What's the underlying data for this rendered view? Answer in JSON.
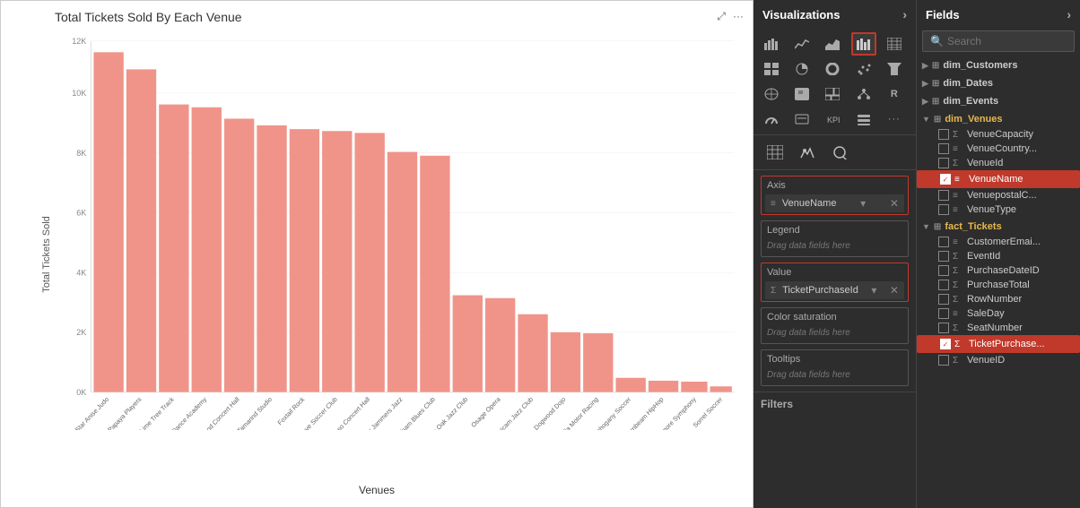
{
  "chart": {
    "title": "Total Tickets Sold By Each Venue",
    "y_label": "Total Tickets Sold",
    "x_label": "Venues",
    "y_ticks": [
      "0K",
      "2K",
      "4K",
      "6K",
      "8K",
      "10K",
      "12K"
    ],
    "bars": [
      {
        "label": "Star Anise Judo",
        "value": 11600
      },
      {
        "label": "Papaya Players",
        "value": 11000
      },
      {
        "label": "Lime Tree Track",
        "value": 9800
      },
      {
        "label": "Poplar Dance Academy",
        "value": 9700
      },
      {
        "label": "Cottonwood Concert Hall",
        "value": 9300
      },
      {
        "label": "Tamarind Studio",
        "value": 9100
      },
      {
        "label": "Foxtail Rock",
        "value": 9000
      },
      {
        "label": "Mangrove Soccer Club",
        "value": 8900
      },
      {
        "label": "Contoso Concert Hall",
        "value": 8850
      },
      {
        "label": "Juniper Jammers Jazz",
        "value": 8200
      },
      {
        "label": "Balsam Blues Club",
        "value": 8050
      },
      {
        "label": "Blue Oak Jazz Club",
        "value": 3300
      },
      {
        "label": "Osage Opera",
        "value": 3200
      },
      {
        "label": "Fabricam Jazz Club",
        "value": 2650
      },
      {
        "label": "Dogwood Dojo",
        "value": 2050
      },
      {
        "label": "Magnolia Motor Racing",
        "value": 2000
      },
      {
        "label": "Mahogany Soccer",
        "value": 500
      },
      {
        "label": "Hornbeam HipHop",
        "value": 400
      },
      {
        "label": "Sycamore Symphony",
        "value": 350
      },
      {
        "label": "Sorrel Soccer",
        "value": 200
      }
    ],
    "bar_color": "#f0948a",
    "max_value": 12000
  },
  "visualizations": {
    "header": "Visualizations",
    "expand_icon": "›",
    "icons": [
      {
        "name": "bar-chart",
        "symbol": "▦"
      },
      {
        "name": "line-chart",
        "symbol": "📈"
      },
      {
        "name": "column-chart",
        "symbol": "▮▮"
      },
      {
        "name": "table-chart",
        "symbol": "⊞",
        "active": true
      },
      {
        "name": "matrix",
        "symbol": "⊟"
      },
      {
        "name": "area-chart",
        "symbol": "⌇"
      },
      {
        "name": "pie-chart",
        "symbol": "◕"
      },
      {
        "name": "donut-chart",
        "symbol": "◎"
      },
      {
        "name": "scatter-chart",
        "symbol": "⋮⋮"
      },
      {
        "name": "waterfall",
        "symbol": "↕"
      },
      {
        "name": "funnel",
        "symbol": "⊽"
      },
      {
        "name": "gauge",
        "symbol": "◑"
      },
      {
        "name": "card",
        "symbol": "▭"
      },
      {
        "name": "kpi",
        "symbol": "K"
      },
      {
        "name": "slicer",
        "symbol": "⊶"
      },
      {
        "name": "map",
        "symbol": "🗺"
      },
      {
        "name": "filled-map",
        "symbol": "⬛"
      },
      {
        "name": "treemap",
        "symbol": "⊠"
      },
      {
        "name": "decomp",
        "symbol": "⑃"
      },
      {
        "name": "r-visual",
        "symbol": "R"
      },
      {
        "name": "more",
        "symbol": "···"
      }
    ],
    "toolbar": [
      {
        "name": "fields-icon",
        "symbol": "⊞"
      },
      {
        "name": "format-icon",
        "symbol": "🖌"
      },
      {
        "name": "analytics-icon",
        "symbol": "🔍"
      }
    ],
    "axis": {
      "label": "Axis",
      "field": "VenueName",
      "highlighted": true
    },
    "legend": {
      "label": "Legend",
      "placeholder": "Drag data fields here"
    },
    "value": {
      "label": "Value",
      "field": "TicketPurchaseId",
      "highlighted": true
    },
    "color_saturation": {
      "label": "Color saturation",
      "placeholder": "Drag data fields here"
    },
    "tooltips": {
      "label": "Tooltips",
      "placeholder": "Drag data fields here"
    },
    "filters": {
      "label": "Filters"
    }
  },
  "fields": {
    "header": "Fields",
    "expand_icon": "›",
    "search_placeholder": "Search",
    "groups": [
      {
        "name": "dim_Customers",
        "expanded": false,
        "items": []
      },
      {
        "name": "dim_Dates",
        "expanded": false,
        "items": []
      },
      {
        "name": "dim_Events",
        "expanded": false,
        "items": []
      },
      {
        "name": "dim_Venues",
        "expanded": true,
        "items": [
          {
            "label": "VenueCapacity",
            "type": "sigma",
            "checked": false,
            "highlighted": false
          },
          {
            "label": "VenueCountry...",
            "type": "text",
            "checked": false,
            "highlighted": false
          },
          {
            "label": "VenueId",
            "type": "sigma",
            "checked": false,
            "highlighted": false
          },
          {
            "label": "VenueName",
            "type": "text",
            "checked": true,
            "highlighted": true
          },
          {
            "label": "VenuepostalC...",
            "type": "text",
            "checked": false,
            "highlighted": false
          },
          {
            "label": "VenueType",
            "type": "text",
            "checked": false,
            "highlighted": false
          }
        ]
      },
      {
        "name": "fact_Tickets",
        "expanded": true,
        "items": [
          {
            "label": "CustomerEmai...",
            "type": "text",
            "checked": false,
            "highlighted": false
          },
          {
            "label": "EventId",
            "type": "sigma",
            "checked": false,
            "highlighted": false
          },
          {
            "label": "PurchaseDateID",
            "type": "sigma",
            "checked": false,
            "highlighted": false
          },
          {
            "label": "PurchaseTotal",
            "type": "sigma",
            "checked": false,
            "highlighted": false
          },
          {
            "label": "RowNumber",
            "type": "sigma",
            "checked": false,
            "highlighted": false
          },
          {
            "label": "SaleDay",
            "type": "text",
            "checked": false,
            "highlighted": false
          },
          {
            "label": "SeatNumber",
            "type": "sigma",
            "checked": false,
            "highlighted": false
          },
          {
            "label": "TicketPurchase...",
            "type": "sigma",
            "checked": true,
            "highlighted": true
          },
          {
            "label": "VenueID",
            "type": "sigma",
            "checked": false,
            "highlighted": false
          }
        ]
      }
    ]
  },
  "top_bar": {
    "expand_icon": "⤢",
    "more_icon": "···"
  }
}
